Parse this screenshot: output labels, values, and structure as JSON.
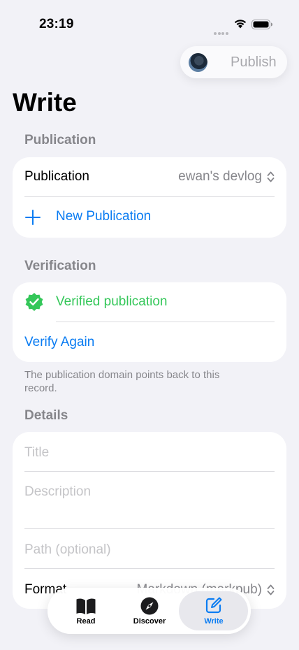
{
  "status_bar": {
    "time": "23:19"
  },
  "header": {
    "publish_label": "Publish",
    "title": "Write"
  },
  "publication_section": {
    "header": "Publication",
    "row_label": "Publication",
    "row_value": "ewan's devlog",
    "new_publication_label": "New Publication"
  },
  "verification_section": {
    "header": "Verification",
    "status_label": "Verified publication",
    "verify_again_label": "Verify Again",
    "footer": "The publication domain points back to this record."
  },
  "details_section": {
    "header": "Details",
    "title_placeholder": "Title",
    "description_placeholder": "Description",
    "path_placeholder": "Path (optional)",
    "format_label": "Format",
    "format_value": "Markdown (markpub)"
  },
  "tab_bar": {
    "tabs": [
      {
        "label": "Read",
        "icon": "book-icon"
      },
      {
        "label": "Discover",
        "icon": "compass-icon"
      },
      {
        "label": "Write",
        "icon": "compose-icon",
        "active": true
      }
    ]
  },
  "colors": {
    "accent": "#0a7cf2",
    "verified": "#34c759",
    "background": "#f2f2f7"
  }
}
